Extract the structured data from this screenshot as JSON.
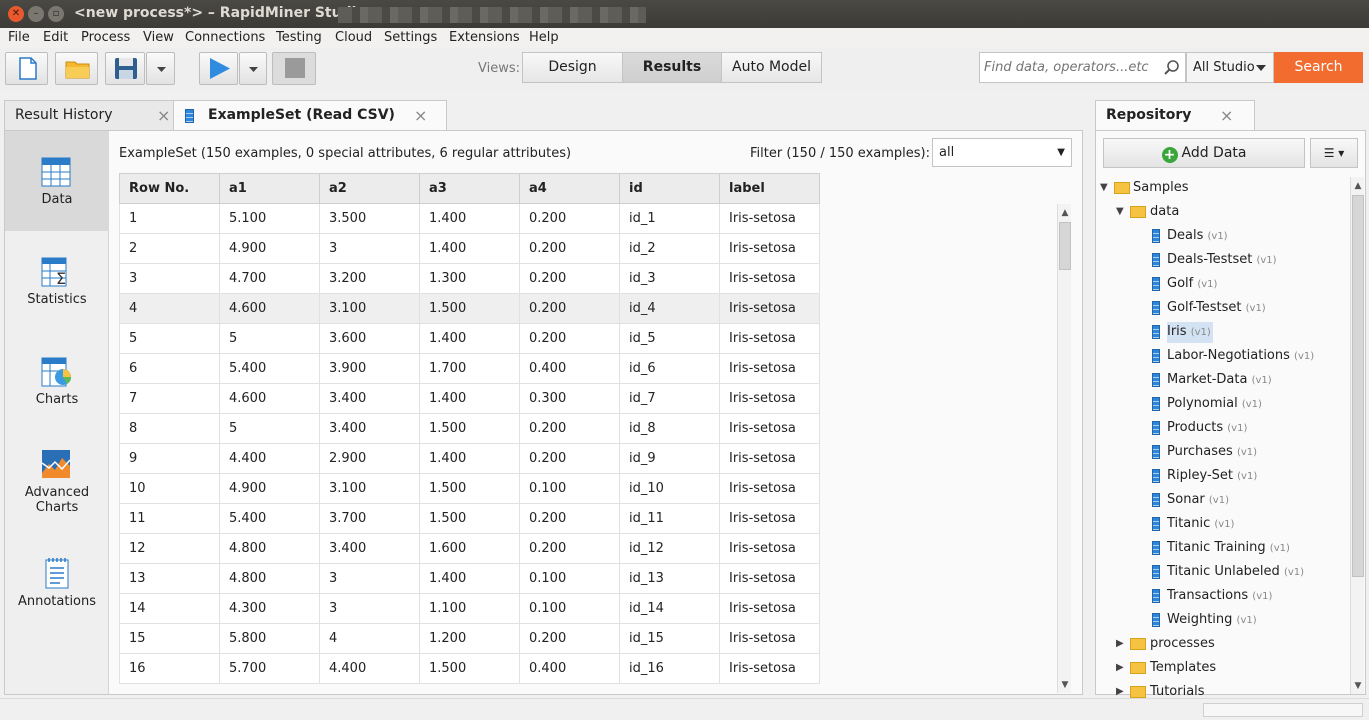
{
  "window": {
    "title": "<new process*> – RapidMiner Studio"
  },
  "menu": [
    "File",
    "Edit",
    "Process",
    "View",
    "Connections",
    "Testing",
    "Cloud",
    "Settings",
    "Extensions",
    "Help"
  ],
  "toolbar": {
    "views_label": "Views:",
    "views": [
      "Design",
      "Results",
      "Auto Model"
    ],
    "active_view": "Results",
    "search_placeholder": "Find data, operators...etc",
    "scope": "All Studio",
    "search_button": "Search"
  },
  "tabs": {
    "result_history": "Result History",
    "exampleset": "ExampleSet (Read CSV)",
    "repository": "Repository"
  },
  "side_nav": [
    {
      "label": "Data",
      "icon": "data-table-icon"
    },
    {
      "label": "Statistics",
      "icon": "statistics-icon"
    },
    {
      "label": "Charts",
      "icon": "charts-icon"
    },
    {
      "label": "Advanced Charts",
      "icon": "advanced-charts-icon"
    },
    {
      "label": "Annotations",
      "icon": "annotations-icon"
    }
  ],
  "exampleset": {
    "info": "ExampleSet (150 examples, 0 special attributes, 6 regular attributes)",
    "filter_label": "Filter (150 / 150 examples):",
    "filter_value": "all",
    "columns": [
      "Row No.",
      "a1",
      "a2",
      "a3",
      "a4",
      "id",
      "label"
    ],
    "rows": [
      [
        "1",
        "5.100",
        "3.500",
        "1.400",
        "0.200",
        "id_1",
        "Iris-setosa"
      ],
      [
        "2",
        "4.900",
        "3",
        "1.400",
        "0.200",
        "id_2",
        "Iris-setosa"
      ],
      [
        "3",
        "4.700",
        "3.200",
        "1.300",
        "0.200",
        "id_3",
        "Iris-setosa"
      ],
      [
        "4",
        "4.600",
        "3.100",
        "1.500",
        "0.200",
        "id_4",
        "Iris-setosa"
      ],
      [
        "5",
        "5",
        "3.600",
        "1.400",
        "0.200",
        "id_5",
        "Iris-setosa"
      ],
      [
        "6",
        "5.400",
        "3.900",
        "1.700",
        "0.400",
        "id_6",
        "Iris-setosa"
      ],
      [
        "7",
        "4.600",
        "3.400",
        "1.400",
        "0.300",
        "id_7",
        "Iris-setosa"
      ],
      [
        "8",
        "5",
        "3.400",
        "1.500",
        "0.200",
        "id_8",
        "Iris-setosa"
      ],
      [
        "9",
        "4.400",
        "2.900",
        "1.400",
        "0.200",
        "id_9",
        "Iris-setosa"
      ],
      [
        "10",
        "4.900",
        "3.100",
        "1.500",
        "0.100",
        "id_10",
        "Iris-setosa"
      ],
      [
        "11",
        "5.400",
        "3.700",
        "1.500",
        "0.200",
        "id_11",
        "Iris-setosa"
      ],
      [
        "12",
        "4.800",
        "3.400",
        "1.600",
        "0.200",
        "id_12",
        "Iris-setosa"
      ],
      [
        "13",
        "4.800",
        "3",
        "1.400",
        "0.100",
        "id_13",
        "Iris-setosa"
      ],
      [
        "14",
        "4.300",
        "3",
        "1.100",
        "0.100",
        "id_14",
        "Iris-setosa"
      ],
      [
        "15",
        "5.800",
        "4",
        "1.200",
        "0.200",
        "id_15",
        "Iris-setosa"
      ],
      [
        "16",
        "5.700",
        "4.400",
        "1.500",
        "0.400",
        "id_16",
        "Iris-setosa"
      ]
    ]
  },
  "repository": {
    "add_data": "Add Data",
    "root": "Samples",
    "folder": "data",
    "version": "(v1)",
    "items": [
      "Deals",
      "Deals-Testset",
      "Golf",
      "Golf-Testset",
      "Iris",
      "Labor-Negotiations",
      "Market-Data",
      "Polynomial",
      "Products",
      "Purchases",
      "Ripley-Set",
      "Sonar",
      "Titanic",
      "Titanic Training",
      "Titanic Unlabeled",
      "Transactions",
      "Weighting"
    ],
    "selected": "Iris",
    "folders_after": [
      "processes",
      "Templates",
      "Tutorials"
    ]
  },
  "colors": {
    "search_accent": "#f26b2f",
    "dataset_blue": "#2f86d6",
    "folder_yellow": "#f5c242"
  }
}
